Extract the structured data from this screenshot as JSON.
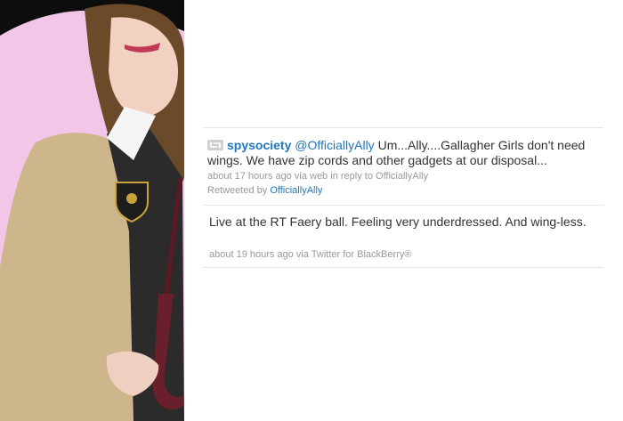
{
  "timeline": {
    "tweets": [
      {
        "retweet_icon": "retweet-icon",
        "username": "spysociety",
        "mention": "@OfficiallyAlly",
        "text": " Um...Ally....Gallagher Girls don't need wings. We have zip cords and other gadgets at our disposal...",
        "time": "about 17 hours ago",
        "via_label": "via",
        "source": "web",
        "in_reply_label": "in reply to",
        "reply_to": "OfficiallyAlly",
        "retweeted_by_label": "Retweeted by",
        "retweeted_by": "OfficiallyAlly"
      },
      {
        "text": "Live at the RT Faery ball. Feeling very underdressed. And wing-less.",
        "time": "about 19 hours ago",
        "via_label": "via",
        "source": "Twitter for BlackBerry®"
      }
    ]
  },
  "colors": {
    "link": "#2276bb",
    "text": "#333333",
    "meta": "#999999",
    "background_pink": "#f2c6e6"
  }
}
